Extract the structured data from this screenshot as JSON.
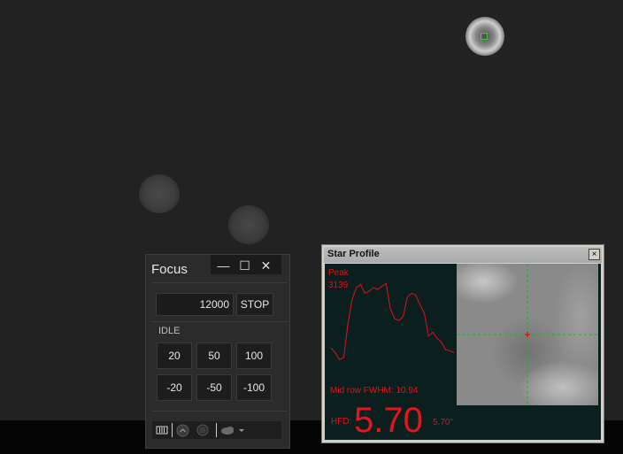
{
  "focus": {
    "title": "Focus",
    "window_controls": {
      "minimize": "—",
      "maximize": "☐",
      "close": "✕"
    },
    "position": "12000",
    "stop_label": "STOP",
    "status": "IDLE",
    "steps_up": [
      "20",
      "50",
      "100"
    ],
    "steps_down": [
      "-20",
      "-50",
      "-100"
    ]
  },
  "star_profile": {
    "title": "Star Profile",
    "close": "×",
    "peak_label": "Peak",
    "peak_value": "3139",
    "fwhm_text": "Mid row FWHM: 10.94",
    "hfd_label": "HFD:",
    "hfd_value": "5.70",
    "hfd_arcsec": "5.70\"",
    "profile_color": "#e0121a",
    "profile": [
      0.3,
      0.25,
      0.18,
      0.2,
      0.55,
      0.8,
      0.92,
      0.95,
      0.86,
      0.88,
      0.92,
      0.9,
      0.93,
      0.96,
      0.7,
      0.6,
      0.58,
      0.62,
      0.82,
      0.86,
      0.84,
      0.74,
      0.66,
      0.42,
      0.46,
      0.4,
      0.36,
      0.28,
      0.27,
      0.25
    ]
  }
}
